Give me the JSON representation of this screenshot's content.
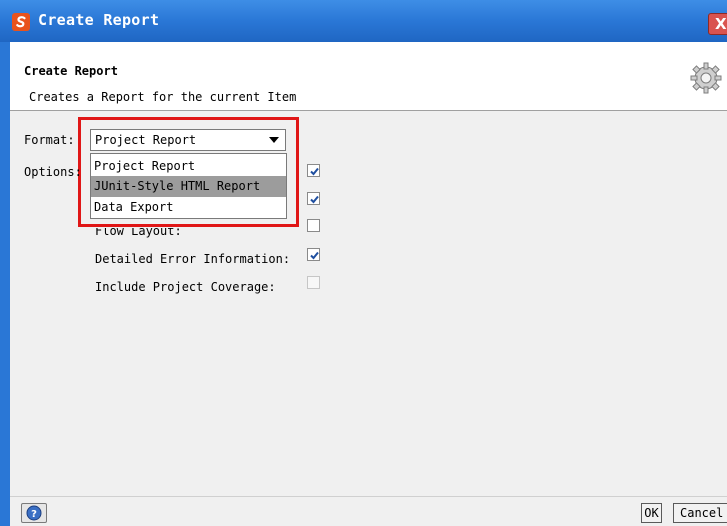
{
  "window": {
    "title": "Create Report",
    "close_label": "X"
  },
  "header": {
    "title": "Create Report",
    "description": "Creates a Report for the current Item"
  },
  "format": {
    "label": "Format:",
    "selected": "Project Report",
    "options": [
      "Project Report",
      "JUnit-Style HTML Report",
      "Data Export"
    ],
    "hovered_option": "JUnit-Style HTML Report"
  },
  "options": {
    "label": "Options:",
    "items": [
      {
        "label": "",
        "checked": true,
        "enabled": true
      },
      {
        "label": "",
        "checked": true,
        "enabled": true
      },
      {
        "label": "Flow Layout:",
        "checked": false,
        "enabled": true
      },
      {
        "label": "Detailed Error Information:",
        "checked": true,
        "enabled": true
      },
      {
        "label": "Include Project Coverage:",
        "checked": false,
        "enabled": false
      }
    ]
  },
  "footer": {
    "ok_label": "OK",
    "cancel_label": "Cancel"
  },
  "colors": {
    "titlebar": "#2a77d6",
    "highlight_border": "#e01616",
    "check": "#1f4fa0"
  }
}
